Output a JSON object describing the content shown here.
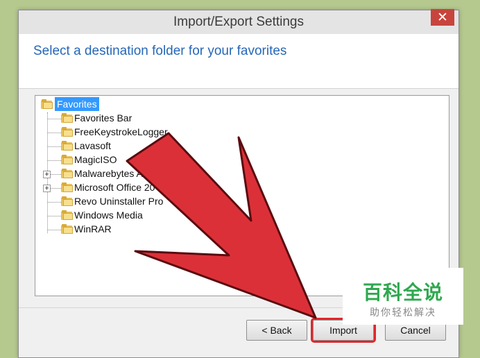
{
  "window": {
    "title": "Import/Export Settings",
    "close_glyph": "✕"
  },
  "header": {
    "heading": "Select a destination folder for your favorites"
  },
  "tree": {
    "root": {
      "label": "Favorites",
      "icon": "folder-icon",
      "selected": true
    },
    "children": [
      {
        "label": "Favorites Bar",
        "expandable": false
      },
      {
        "label": "FreeKeystrokeLogger",
        "expandable": false
      },
      {
        "label": "Lavasoft",
        "expandable": false
      },
      {
        "label": "MagicISO",
        "expandable": false
      },
      {
        "label": "Malwarebytes A",
        "expandable": true
      },
      {
        "label": "Microsoft Office 20",
        "expandable": true
      },
      {
        "label": "Revo Uninstaller Pro",
        "expandable": false
      },
      {
        "label": "Windows Media",
        "expandable": false
      },
      {
        "label": "WinRAR",
        "expandable": false
      }
    ],
    "expand_glyph": "+"
  },
  "buttons": {
    "back": "< Back",
    "import": "Import",
    "cancel": "Cancel"
  },
  "annotation": {
    "arrow_color": "#dc3038",
    "highlight_color": "#e2252b"
  },
  "watermark": {
    "title": "百科全说",
    "subtitle": "助你轻松解决"
  }
}
